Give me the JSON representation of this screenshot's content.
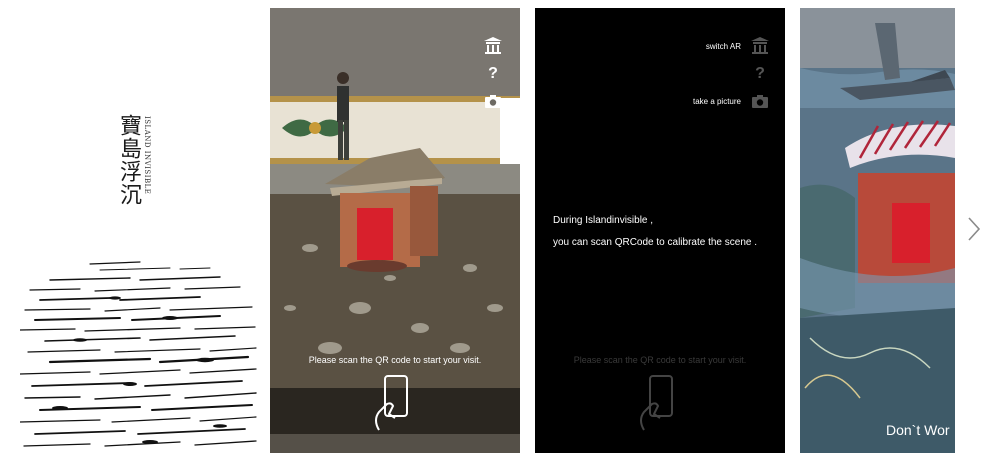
{
  "splash": {
    "title_cn": "寶島浮沉",
    "subtitle": "ISLAND INVISIBLE"
  },
  "camera": {
    "hint": "Please scan the QR code to start your visit."
  },
  "instructions": {
    "switch_label": "switch AR",
    "help_label": "?",
    "picture_label": "take a picture",
    "line1": "During Islandinvisible ,",
    "line2": "you can scan QRCode to calibrate the scene .",
    "hint": "Please scan the QR code to start your visit."
  },
  "ar": {
    "caption": "Don`t Wor"
  },
  "icons": {
    "temple": "temple-icon",
    "help": "help-icon",
    "camera": "camera-icon",
    "hand_phone": "hand-phone-icon",
    "next": "chevron-right-icon",
    "prev": "chevron-left-icon"
  },
  "colors": {
    "background": "#ffffff",
    "overlay": "#000000",
    "qr_red": "#d8202c"
  }
}
